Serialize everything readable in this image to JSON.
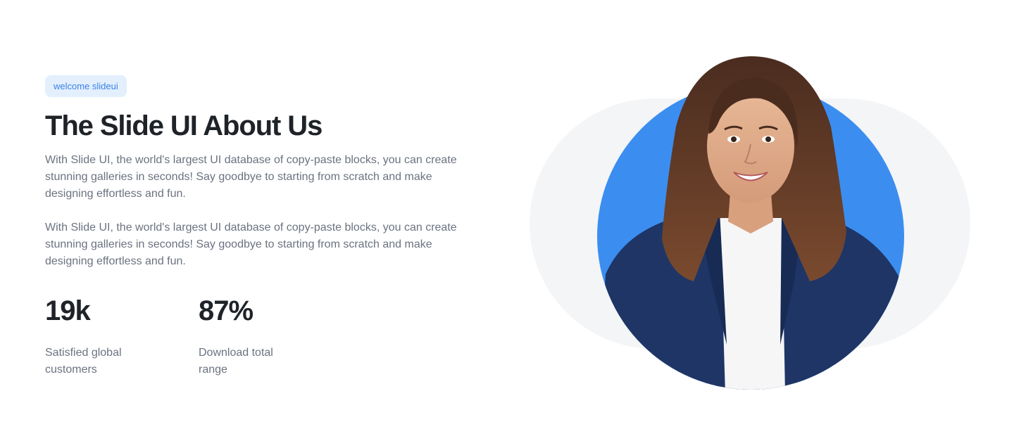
{
  "hero": {
    "badge": "welcome slideui",
    "title": "The Slide UI About Us",
    "paragraphs": [
      "With Slide UI, the world's largest UI database of copy-paste blocks, you can create stunning galleries in seconds! Say goodbye to starting from scratch and make designing effortless and fun.",
      "With Slide UI, the world's largest UI database of copy-paste blocks, you can create stunning galleries in seconds! Say goodbye to starting from scratch and make designing effortless and fun."
    ]
  },
  "stats": [
    {
      "value": "19k",
      "label": "Satisfied global customers"
    },
    {
      "value": "87%",
      "label": "Download total range"
    }
  ],
  "colors": {
    "badge_bg": "#e3effd",
    "badge_text": "#3b82e8",
    "circle_blue": "#3b8ef0",
    "heading": "#1f2328",
    "body_text": "#6b7280",
    "blob": "#f4f5f7"
  },
  "image": {
    "subject": "smiling woman in navy blazer portrait"
  }
}
